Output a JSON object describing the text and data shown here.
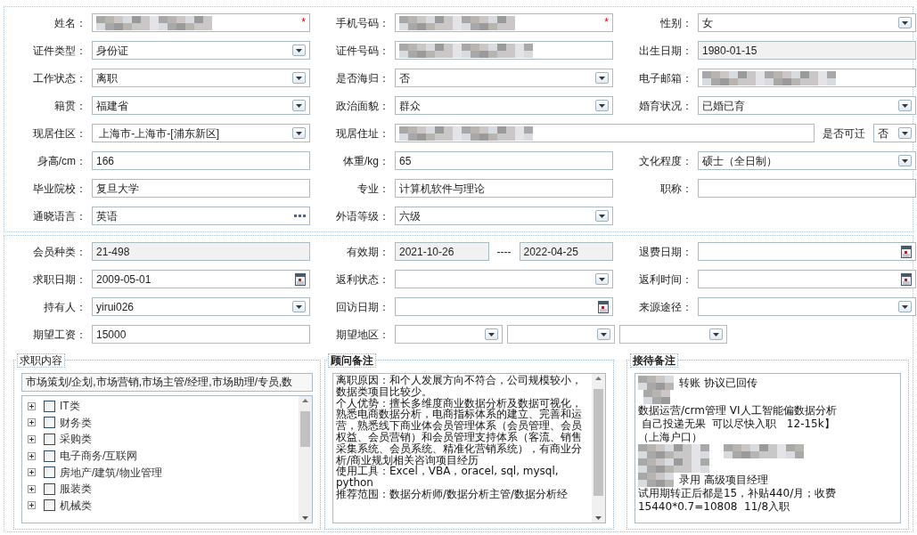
{
  "profile_rows": [
    [
      {
        "label": "姓名：",
        "fields": [
          {
            "kind": "text",
            "redacted": true,
            "required_mark": "*"
          }
        ]
      },
      {
        "label": "手机号码：",
        "fields": [
          {
            "kind": "text",
            "redacted": true,
            "required_mark": "*"
          }
        ]
      },
      {
        "label": "性别：",
        "fields": [
          {
            "kind": "select",
            "value": "女"
          }
        ]
      }
    ],
    [
      {
        "label": "证件类型：",
        "fields": [
          {
            "kind": "select",
            "value": "身份证"
          }
        ]
      },
      {
        "label": "证件号码：",
        "fields": [
          {
            "kind": "text",
            "redacted": true
          }
        ]
      },
      {
        "label": "出生日期：",
        "fields": [
          {
            "kind": "readonly",
            "value": "1980-01-15"
          }
        ]
      }
    ],
    [
      {
        "label": "工作状态：",
        "fields": [
          {
            "kind": "select",
            "value": "离职"
          }
        ]
      },
      {
        "label": "是否海归：",
        "fields": [
          {
            "kind": "select",
            "value": "否"
          }
        ]
      },
      {
        "label": "电子邮箱：",
        "fields": [
          {
            "kind": "text",
            "redacted": true
          }
        ]
      }
    ],
    [
      {
        "label": "籍贯：",
        "fields": [
          {
            "kind": "select",
            "value": "福建省"
          }
        ]
      },
      {
        "label": "政治面貌：",
        "fields": [
          {
            "kind": "select",
            "value": "群众"
          }
        ]
      },
      {
        "label": "婚育状况：",
        "fields": [
          {
            "kind": "select",
            "value": "已婚已育"
          }
        ]
      }
    ],
    [
      {
        "label": "现居住区：",
        "fields": [
          {
            "kind": "select",
            "value": " 上海市-上海市-[浦东新区]"
          }
        ]
      },
      {
        "label": "现居住址：",
        "wide": true,
        "fields": [
          {
            "kind": "text",
            "redacted": true
          },
          {
            "kind": "label",
            "value": "是否可迁"
          },
          {
            "kind": "mini-select",
            "value": "否"
          }
        ]
      }
    ],
    [
      {
        "label": "身高/cm：",
        "fields": [
          {
            "kind": "text",
            "value": "166"
          }
        ]
      },
      {
        "label": "体重/kg：",
        "fields": [
          {
            "kind": "text",
            "value": "65"
          }
        ]
      },
      {
        "label": "文化程度：",
        "fields": [
          {
            "kind": "select",
            "value": "硕士（全日制）"
          }
        ]
      }
    ],
    [
      {
        "label": "毕业院校：",
        "fields": [
          {
            "kind": "text",
            "value": "复旦大学"
          }
        ]
      },
      {
        "label": "专业：",
        "fields": [
          {
            "kind": "text",
            "value": "计算机软件与理论"
          }
        ]
      },
      {
        "label": "职称：",
        "fields": [
          {
            "kind": "text"
          }
        ]
      }
    ],
    [
      {
        "label": "通晓语言：",
        "fields": [
          {
            "kind": "picker",
            "value": "英语"
          }
        ]
      },
      {
        "label": "外语等级：",
        "fields": [
          {
            "kind": "select",
            "value": "六级"
          }
        ]
      }
    ]
  ],
  "member_rows": [
    [
      {
        "label": "会员种类：",
        "fields": [
          {
            "kind": "readonly",
            "value": "21-498"
          }
        ]
      },
      {
        "label": "有效期：",
        "fields": [
          {
            "kind": "readonly",
            "value": "2021-10-26"
          },
          {
            "kind": "label",
            "value": "----"
          },
          {
            "kind": "readonly",
            "value": "2022-04-25"
          }
        ]
      },
      {
        "label": "退费日期：",
        "fields": [
          {
            "kind": "date"
          }
        ]
      }
    ],
    [
      {
        "label": "求职日期：",
        "fields": [
          {
            "kind": "date",
            "value": "2009-05-01"
          }
        ]
      },
      {
        "label": "返利状态：",
        "fields": [
          {
            "kind": "select"
          }
        ]
      },
      {
        "label": "返利时间：",
        "fields": [
          {
            "kind": "date"
          }
        ]
      }
    ],
    [
      {
        "label": "持有人：",
        "fields": [
          {
            "kind": "select",
            "value": "yirui026"
          }
        ]
      },
      {
        "label": "回访日期：",
        "fields": [
          {
            "kind": "date"
          }
        ]
      },
      {
        "label": "来源途径：",
        "fields": [
          {
            "kind": "select"
          }
        ]
      }
    ],
    [
      {
        "label": "期望工资：",
        "fields": [
          {
            "kind": "text",
            "value": "15000"
          }
        ]
      },
      {
        "label": "期望地区：",
        "wide": true,
        "fields": [
          {
            "kind": "region-select"
          },
          {
            "kind": "region-select"
          },
          {
            "kind": "region-select"
          }
        ]
      }
    ]
  ],
  "job_intent": {
    "title": "求职内容",
    "value": "市场策划/企划,市场营销,市场主管/经理,市场助理/专员,数",
    "categories": [
      {
        "label": "IT类",
        "checked": false,
        "expanded": false
      },
      {
        "label": "财务类",
        "checked": false,
        "expanded": false
      },
      {
        "label": "采购类",
        "checked": false,
        "expanded": false
      },
      {
        "label": "电子商务/互联网",
        "checked": false,
        "expanded": false
      },
      {
        "label": "房地产/建筑/物业管理",
        "checked": false,
        "expanded": false
      },
      {
        "label": "服装类",
        "checked": false,
        "expanded": false
      },
      {
        "label": "机械类",
        "checked": false,
        "expanded": false
      }
    ]
  },
  "advisor_notes": {
    "title": "顾问备注",
    "paragraphs": [
      "离职原因：和个人发展方向不符合，公司规模较小，数据类项目比较少。",
      "个人优势：擅长多维度商业数据分析及数据可视化，熟悉电商数据分析，电商指标体系的建立、完善和运营，熟悉线下商业体会员管理体系（会员管理、会员权益、会员营销）和会员管理支持体系（客流、销售采集系统、会员系统、精准化营销系统），有商业分析/商业规划相关咨询项目经历",
      "使用工具：Excel，VBA，oracel, sql, mysql, python",
      "推荐范围：数据分析师/数据分析主管/数据分析经"
    ]
  },
  "reception_notes": {
    "title": "接待备注",
    "lines": [
      {
        "kind": "prefix",
        "text": "转账 协议已回传"
      },
      {
        "kind": "short"
      },
      {
        "kind": "plain",
        "text": "数据运营/crm管理 VI人工智能偏数据分析"
      },
      {
        "kind": "plain",
        "text": " 自己投递无果  可以尽快入职   12-15k】"
      },
      {
        "kind": "plain",
        "text": "（上海户口）"
      },
      {
        "kind": "full"
      },
      {
        "kind": "full"
      },
      {
        "kind": "prefix",
        "text": "录用 高级项目经理"
      },
      {
        "kind": "plain",
        "text": "试用期转正后都是15，补贴440/月；收费"
      },
      {
        "kind": "plain",
        "text": "15440*0.7=10808  11/8入职"
      }
    ]
  }
}
